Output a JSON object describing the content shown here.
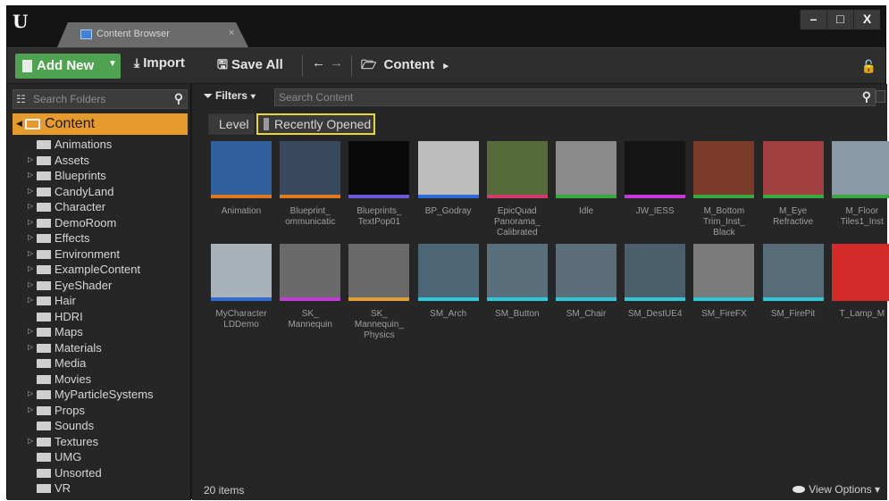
{
  "window": {
    "tab_label": "Content Browser",
    "tab_close": "×",
    "controls": [
      "–",
      "□",
      "X"
    ]
  },
  "toolbar": {
    "add_new": "Add New",
    "import": "Import",
    "save_all": "Save All",
    "path_folder": "Content",
    "path_arrow": "▸"
  },
  "sidebar": {
    "search_placeholder": "Search Folders",
    "root": "Content",
    "items": [
      {
        "label": "Animations",
        "expandable": false
      },
      {
        "label": "Assets",
        "expandable": true
      },
      {
        "label": "Blueprints",
        "expandable": true
      },
      {
        "label": "CandyLand",
        "expandable": true
      },
      {
        "label": "Character",
        "expandable": true
      },
      {
        "label": "DemoRoom",
        "expandable": true
      },
      {
        "label": "Effects",
        "expandable": true
      },
      {
        "label": "Environment",
        "expandable": true
      },
      {
        "label": "ExampleContent",
        "expandable": true
      },
      {
        "label": "EyeShader",
        "expandable": true
      },
      {
        "label": "Hair",
        "expandable": true
      },
      {
        "label": "HDRI",
        "expandable": false
      },
      {
        "label": "Maps",
        "expandable": true
      },
      {
        "label": "Materials",
        "expandable": true
      },
      {
        "label": "Media",
        "expandable": false
      },
      {
        "label": "Movies",
        "expandable": false
      },
      {
        "label": "MyParticleSystems",
        "expandable": true
      },
      {
        "label": "Props",
        "expandable": true
      },
      {
        "label": "Sounds",
        "expandable": false
      },
      {
        "label": "Textures",
        "expandable": true
      },
      {
        "label": "UMG",
        "expandable": false
      },
      {
        "label": "Unsorted",
        "expandable": false
      },
      {
        "label": "VR",
        "expandable": false
      }
    ]
  },
  "content": {
    "filters_label": "Filters",
    "search_placeholder": "Search Content",
    "filter_chips": [
      "Level",
      "Recently Opened"
    ],
    "assets": [
      {
        "label": "Animation",
        "thumb": "#2f5f9e",
        "bar": "#e07a1f"
      },
      {
        "label": "Blueprint_\nommunicatic",
        "thumb": "#3a4a5e",
        "bar": "#e07a1f"
      },
      {
        "label": "Blueprints_\nTextPop01",
        "thumb": "#0a0a0a",
        "bar": "#6b5bd6"
      },
      {
        "label": "BP_Godray",
        "thumb": "#bdbdbd",
        "bar": "#2f6cd8"
      },
      {
        "label": "EpicQuad\nPanorama_\nCalibrated",
        "thumb": "#556b3a",
        "bar": "#d43b6c"
      },
      {
        "label": "Idle",
        "thumb": "#8a8a8a",
        "bar": "#3aa840"
      },
      {
        "label": "JW_IESS",
        "thumb": "#151515",
        "bar": "#c23bd6"
      },
      {
        "label": "M_Bottom\nTrim_Inst_\nBlack",
        "thumb": "#7a3a2a",
        "bar": "#3aa840"
      },
      {
        "label": "M_Eye\nRefractive",
        "thumb": "#a04040",
        "bar": "#3aa840"
      },
      {
        "label": "M_Floor\nTiles1_Inst",
        "thumb": "#8a9aa6",
        "bar": "#3aa840"
      },
      {
        "label": "MyCharacter\nLDDemo",
        "thumb": "#a9b2b8",
        "bar": "#2f6cd8"
      },
      {
        "label": "SK_\nMannequin",
        "thumb": "#6a6a6a",
        "bar": "#c23bd6"
      },
      {
        "label": "SK_\nMannequin_\nPhysics",
        "thumb": "#6a6a6a",
        "bar": "#e0a030"
      },
      {
        "label": "SM_Arch",
        "thumb": "#4c6676",
        "bar": "#2fc8d8"
      },
      {
        "label": "SM_Button",
        "thumb": "#5a6f7c",
        "bar": "#2fc8d8"
      },
      {
        "label": "SM_Chair",
        "thumb": "#5c6e7a",
        "bar": "#2fc8d8"
      },
      {
        "label": "SM_DestUE4",
        "thumb": "#4a5e6c",
        "bar": "#2fc8d8"
      },
      {
        "label": "SM_FireFX",
        "thumb": "#7a7a7a",
        "bar": "#2fc8d8"
      },
      {
        "label": "SM_FirePit",
        "thumb": "#586c78",
        "bar": "#2fc8d8"
      },
      {
        "label": "T_Lamp_M",
        "thumb": "#d42a2a",
        "bar": "#d42a2a"
      }
    ],
    "item_count": "20 items",
    "view_options": "View Options ▾"
  }
}
